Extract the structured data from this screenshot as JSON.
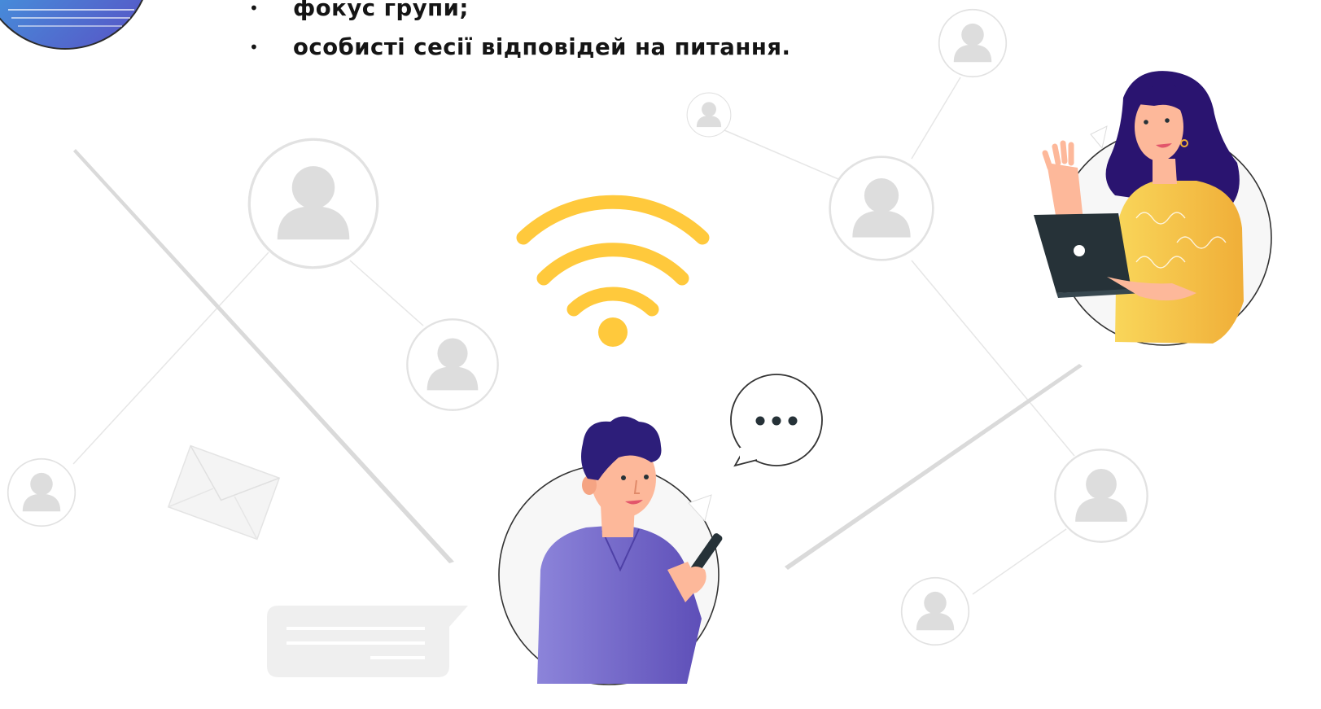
{
  "bullets": [
    {
      "text": "фокус групи;"
    },
    {
      "text": "особисті сесії відповідей на питання."
    }
  ],
  "colors": {
    "wifi": "#FFC93C",
    "placeholder_avatar": "#DDDDDD",
    "network_line": "#E3E3E3",
    "man_shirt": "#7466C6",
    "man_hair": "#2D1E7A",
    "woman_sweater": "#F5C542",
    "woman_hair": "#2A1470",
    "laptop": "#263238",
    "skin": "#FDB89A"
  },
  "icons": [
    "wifi-icon",
    "chat-bubble-icon",
    "envelope-icon",
    "user-avatar-icon",
    "message-card-icon"
  ]
}
